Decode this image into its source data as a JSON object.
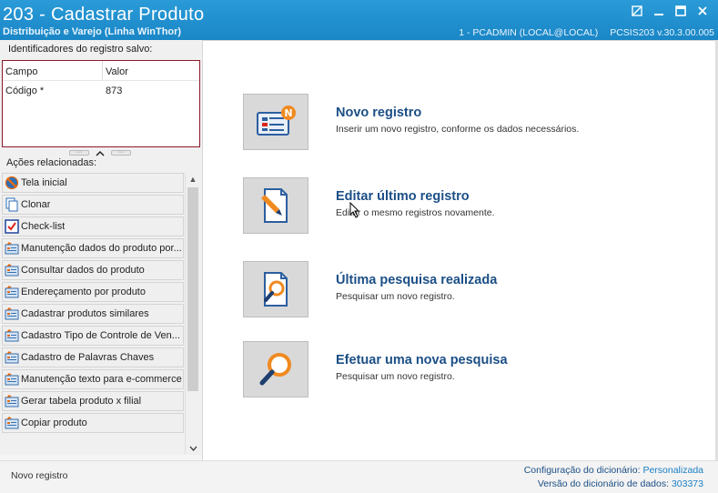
{
  "window": {
    "title": "203 - Cadastrar  Produto",
    "subtitle": "Distribuição e Varejo (Linha WinThor)",
    "user_info": "1 - PCADMIN (LOCAL@LOCAL)",
    "version_info": "PCSIS203  v.30.3.00.005"
  },
  "identifiers": {
    "legend": "Identificadores do registro salvo:",
    "col_field": "Campo",
    "col_value": "Valor",
    "rows": [
      {
        "field": "Código *",
        "value": "873"
      }
    ]
  },
  "actions": {
    "legend": "Ações relacionadas:",
    "items": [
      {
        "label": "Tela inicial",
        "icon": "home-icon"
      },
      {
        "label": "Clonar",
        "icon": "clone-icon"
      },
      {
        "label": "Check-list",
        "icon": "checklist-icon"
      },
      {
        "label": "Manutenção dados do produto por...",
        "icon": "form-icon"
      },
      {
        "label": "Consultar dados do produto",
        "icon": "form-icon"
      },
      {
        "label": "Endereçamento por produto",
        "icon": "form-icon"
      },
      {
        "label": "Cadastrar produtos similares",
        "icon": "form-icon"
      },
      {
        "label": "Cadastro Tipo de Controle de Ven...",
        "icon": "form-icon"
      },
      {
        "label": "Cadastro de Palavras Chaves",
        "icon": "form-icon"
      },
      {
        "label": "Manutenção texto para e-commerce",
        "icon": "form-icon"
      },
      {
        "label": "Gerar tabela produto x filial",
        "icon": "form-icon"
      },
      {
        "label": "Copiar produto",
        "icon": "form-icon"
      }
    ]
  },
  "cards": [
    {
      "title": "Novo registro",
      "desc": "Inserir um novo registro, conforme os dados necessários.",
      "icon": "new-record-icon"
    },
    {
      "title": "Editar último registro",
      "desc": "Editar o mesmo registros novamente.",
      "icon": "edit-record-icon"
    },
    {
      "title": "Última pesquisa realizada",
      "desc": "Pesquisar um novo registro.",
      "icon": "last-search-icon"
    },
    {
      "title": "Efetuar uma nova pesquisa",
      "desc": "Pesquisar um novo registro.",
      "icon": "new-search-icon"
    }
  ],
  "status": {
    "left": "Novo registro",
    "dict_config_label": "Configuração do dicionário:",
    "dict_config_value": "Personalizada",
    "dict_version_label": "Versão do dicionário de dados:",
    "dict_version_value": "303373"
  },
  "colors": {
    "titlebar": "#1a86c6",
    "card_title": "#1b4f86",
    "id_box_border": "#8b1a2a"
  }
}
